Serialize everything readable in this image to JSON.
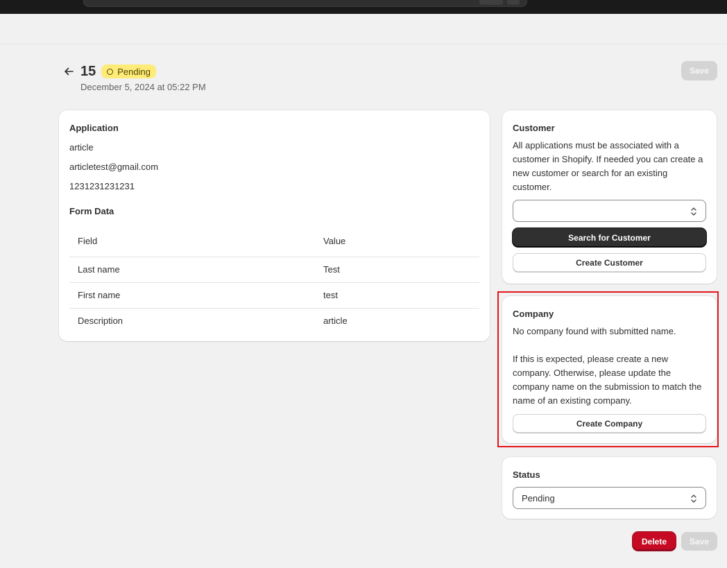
{
  "header": {
    "title": "15",
    "status_badge": "Pending",
    "subtitle": "December 5, 2024 at 05:22 PM",
    "save_label": "Save"
  },
  "application": {
    "heading": "Application",
    "lines": [
      "article",
      "articletest@gmail.com",
      "1231231231231"
    ],
    "form_heading": "Form Data",
    "columns": [
      "Field",
      "Value"
    ],
    "rows": [
      [
        "Last name",
        "Test"
      ],
      [
        "First name",
        "test"
      ],
      [
        "Description",
        "article"
      ]
    ]
  },
  "customer": {
    "heading": "Customer",
    "description": "All applications must be associated with a customer in Shopify. If needed you can create a new customer or search for an existing customer.",
    "select_value": "",
    "search_button": "Search for Customer",
    "create_button": "Create Customer"
  },
  "company": {
    "heading": "Company",
    "message": "No company found with submitted name.",
    "description": "If this is expected, please create a new company. Otherwise, please update the company name on the submission to match the name of an existing company.",
    "create_button": "Create Company"
  },
  "status": {
    "heading": "Status",
    "selected": "Pending"
  },
  "footer": {
    "delete_label": "Delete",
    "save_label": "Save"
  },
  "colors": {
    "badge_bg": "#ffeb78",
    "delete_bg": "#c70a24",
    "highlight": "#e4141b"
  }
}
